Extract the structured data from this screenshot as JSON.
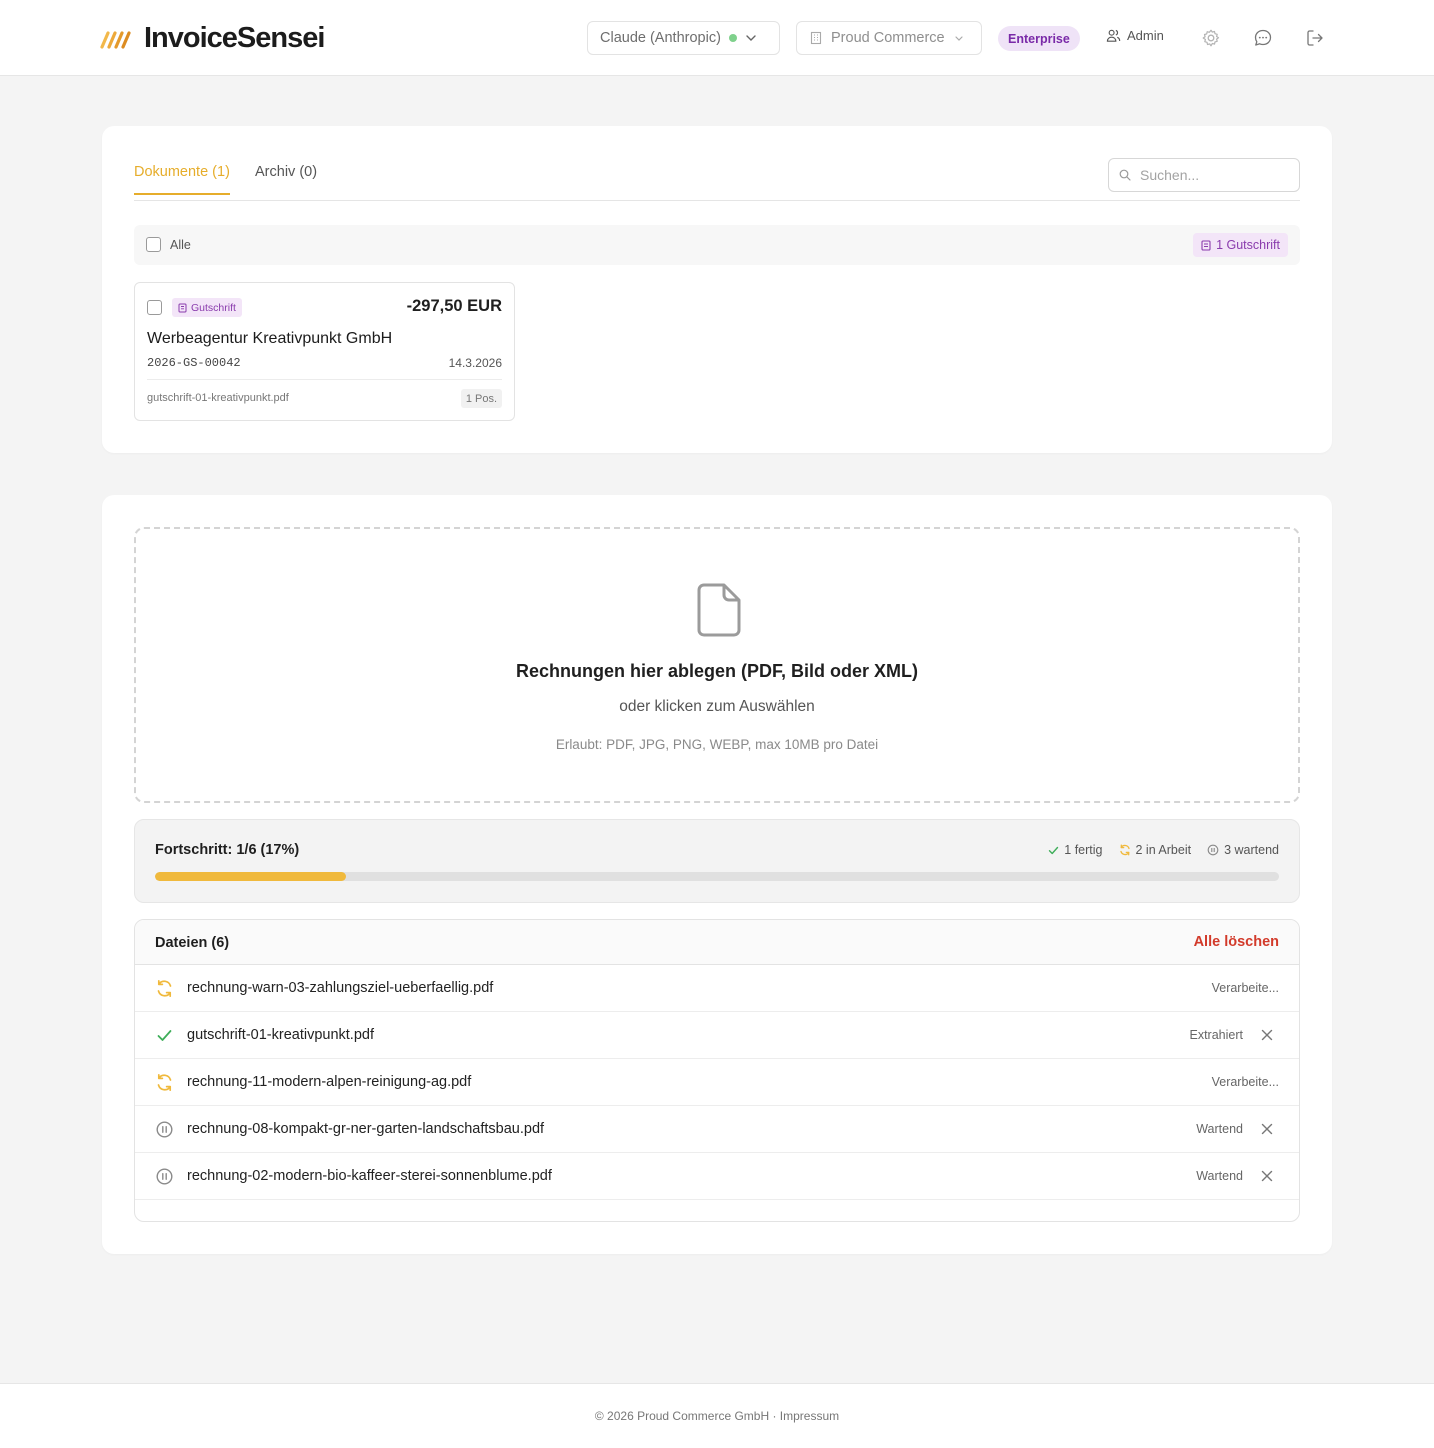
{
  "header": {
    "logo_text": "InvoiceSensei",
    "model_select": "Claude (Anthropic)",
    "company_select": "Proud Commerce",
    "plan_badge": "Enterprise",
    "user_label": "Admin"
  },
  "colors": {
    "accent": "#e6ad2b",
    "progress_fill": "#f0b93c",
    "credit_purple": "#8a3cad",
    "danger": "#d23a2a",
    "success": "#3fae5a"
  },
  "documents": {
    "tabs": [
      {
        "label": "Dokumente (1)",
        "active": true
      },
      {
        "label": "Archiv (0)",
        "active": false
      }
    ],
    "search_placeholder": "Suchen...",
    "select_all_label": "Alle",
    "type_filter_badge": "1 Gutschrift",
    "items": [
      {
        "type_badge": "Gutschrift",
        "amount": "-297,50 EUR",
        "vendor": "Werbeagentur Kreativpunkt GmbH",
        "number": "2026-GS-00042",
        "date": "14.3.2026",
        "filename": "gutschrift-01-kreativpunkt.pdf",
        "positions": "1 Pos."
      }
    ]
  },
  "upload": {
    "title": "Rechnungen hier ablegen (PDF, Bild oder XML)",
    "subtitle": "oder klicken zum Auswählen",
    "hint": "Erlaubt: PDF, JPG, PNG, WEBP, max 10MB pro Datei"
  },
  "progress": {
    "label": "Fortschritt: 1/6 (17%)",
    "fraction": 0.17,
    "done": "1 fertig",
    "in_progress": "2 in Arbeit",
    "waiting": "3 wartend"
  },
  "files": {
    "title": "Dateien (6)",
    "clear_all": "Alle löschen",
    "rows": [
      {
        "name": "rechnung-warn-03-zahlungsziel-ueberfaellig.pdf",
        "status": "Verarbeite...",
        "icon": "processing-icon",
        "removable": false
      },
      {
        "name": "gutschrift-01-kreativpunkt.pdf",
        "status": "Extrahiert",
        "icon": "check-icon",
        "removable": true
      },
      {
        "name": "rechnung-11-modern-alpen-reinigung-ag.pdf",
        "status": "Verarbeite...",
        "icon": "processing-icon",
        "removable": false
      },
      {
        "name": "rechnung-08-kompakt-gr-ner-garten-landschaftsbau.pdf",
        "status": "Wartend",
        "icon": "pause-icon",
        "removable": true
      },
      {
        "name": "rechnung-02-modern-bio-kaffeer-sterei-sonnenblume.pdf",
        "status": "Wartend",
        "icon": "pause-icon",
        "removable": true
      }
    ]
  },
  "footer": {
    "text": "© 2026 Proud Commerce GmbH · Impressum"
  }
}
